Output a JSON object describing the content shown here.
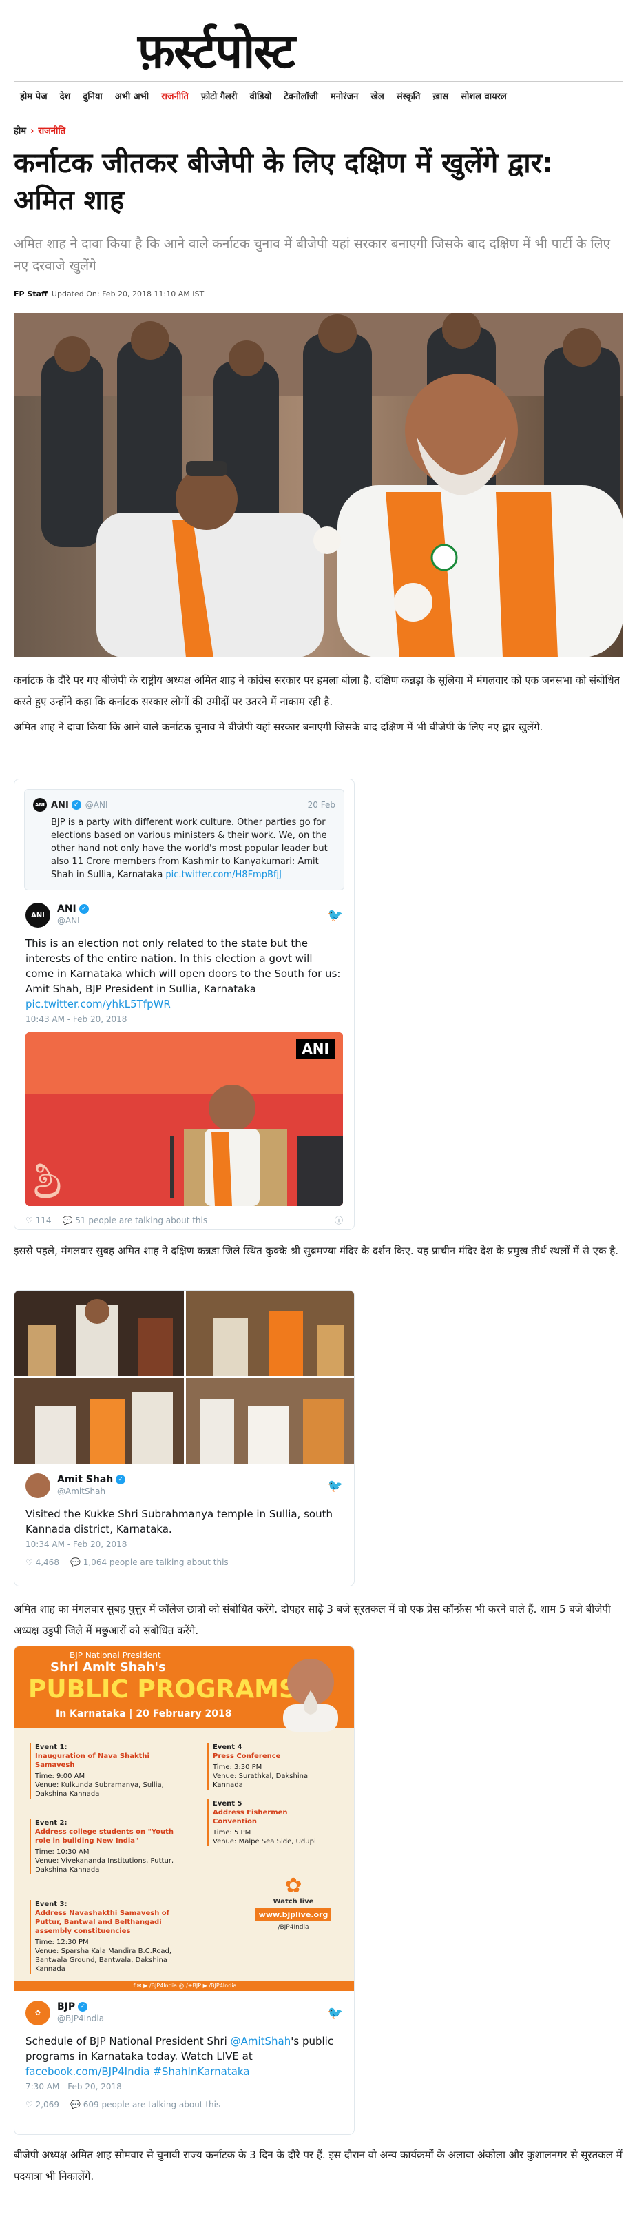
{
  "site": {
    "logo": "फ़र्स्टपोस्ट"
  },
  "nav": [
    "होम पेज",
    "देश",
    "दुनिया",
    "अभी अभी",
    "राजनीति",
    "फ़ोटो गैलरी",
    "वीडियो",
    "टेक्नोलॉजी",
    "मनोरंजन",
    "खेल",
    "संस्कृति",
    "ख़ास",
    "सोशल वायरल"
  ],
  "nav_active": "राजनीति",
  "breadcrumb": {
    "home": "होम",
    "category": "राजनीति"
  },
  "article": {
    "title": "कर्नाटक जीतकर बीजेपी के लिए दक्षिण में खुलेंगे द्वार: अमित शाह",
    "subtitle": "अमित शाह ने दावा किया है कि आने वाले कर्नाटक चुनाव में बीजेपी यहां सरकार बनाएगी जिसके बाद दक्षिण में भी पार्टी के लिए नए दरवाजे खुलेंगे",
    "author": "FP Staff",
    "updated": "Updated On: Feb 20, 2018 11:10 AM IST",
    "p1": "कर्नाटक के दौरे पर गए बीजेपी के राष्ट्रीय अध्यक्ष अमित शाह ने कांग्रेस सरकार पर हमला बोला है. दक्षिण कन्नड़ा के सूलिया में मंगलवार को एक जनसभा को संबोधित करते हुए उन्होंने कहा कि कर्नाटक सरकार लोगों की उमीदों पर उतरने में नाकाम रही है.",
    "p2": "अमित शाह ने दावा किया कि आने वाले कर्नाटक चुनाव में बीजेपी यहां सरकार बनाएगी जिसके बाद दक्षिण में भी बीजेपी के लिए नए द्वार खुलेंगे.",
    "p3": "इससे पहले, मंगलवार सुबह अमित शाह ने दक्षिण कन्नडा जिले स्थित कुक्के श्री सुब्रमण्या मंदिर के दर्शन किए. यह प्राचीन मंदिर देश के प्रमुख तीर्थ स्थलों में से एक है.",
    "p4": "अमित शाह का मंगलवार सुबह पुत्तुर में कॉलेज छात्रों को संबोधित करेंगे. दोपहर साढ़े 3 बजे सूरतकल में वो एक प्रेस कॉन्फ्रेंस भी करने वाले हैं. शाम 5 बजे बीजेपी अध्यक्ष उडुपी जिले में मछुआरों को संबोधित करेंगे.",
    "p5": "बीजेपी अध्यक्ष अमित शाह सोमवार से चुनावी राज्य कर्नाटक के 3 दिन के दौरे पर हैं. इस दौरान वो अन्य कार्यक्रमों के अलावा अंकोला और कुशालनगर से सूरतकल में पदयात्रा भी निकालेंगे."
  },
  "tweet1": {
    "quote_name": "ANI",
    "quote_handle": "@ANI",
    "quote_date": "20 Feb",
    "quote_text": "BJP is a party with different work culture. Other parties go for elections based on various ministers & their work. We, on the other hand not only have the world's most popular leader but also 11 Crore members from Kashmir to Kanyakumari: Amit Shah in Sullia, Karnataka ",
    "quote_link": "pic.twitter.com/H8FmpBfjJ",
    "name": "ANI",
    "handle": "@ANI",
    "text": "This is an election not only related to the state but the interests of the entire nation. In this election a govt will come in Karnataka which will open doors to the South for us: Amit Shah, BJP President in Sullia, Karnataka ",
    "link": "pic.twitter.com/yhkL5TfpWR",
    "time": "10:43 AM - Feb 20, 2018",
    "likes": "114",
    "talking": "51 people are talking about this",
    "watermark": "ANI"
  },
  "tweet2": {
    "name": "Amit Shah",
    "handle": "@AmitShah",
    "text": "Visited the Kukke Shri Subrahmanya temple in Sullia, south Kannada district, Karnataka.",
    "time": "10:34 AM - Feb 20, 2018",
    "likes": "4,468",
    "talking": "1,064 people are talking about this"
  },
  "poster": {
    "kicker": "BJP National President",
    "name": "Shri Amit Shah's",
    "headline": "PUBLIC PROGRAMS",
    "sub": "In Karnataka | 20 February 2018",
    "events": [
      {
        "n": "Event 1:",
        "t": "Inauguration of Nava Shakthi Samavesh",
        "time": "9:00 AM",
        "venue": "Kulkunda Subramanya, Sullia, Dakshina Kannada"
      },
      {
        "n": "Event 2:",
        "t": "Address college students on \"Youth role in building New India\"",
        "time": "10:30 AM",
        "venue": "Vivekananda Institutions, Puttur, Dakshina Kannada"
      },
      {
        "n": "Event 3:",
        "t": "Address Navashakthi Samavesh of Puttur, Bantwal and Belthangadi assembly constituencies",
        "time": "12:30 PM",
        "venue": "Sparsha Kala Mandira B.C.Road, Bantwala Ground, Bantwala, Dakshina Kannada"
      },
      {
        "n": "Event 4",
        "t": "Press Conference",
        "time": "3:30 PM",
        "venue": "Surathkal, Dakshina Kannada"
      },
      {
        "n": "Event 5",
        "t": "Address Fishermen Convention",
        "time": "5 PM",
        "venue": "Malpe Sea Side, Udupi"
      }
    ],
    "time_label": "Time:",
    "venue_label": "Venue:",
    "watch": "Watch live",
    "site": "www.bjplive.org",
    "social": "/BJP4India",
    "footer": "f  ✉  ▶ /BJP4India   @   /+BJP   ▶ /BJP4India"
  },
  "tweet3": {
    "name": "BJP",
    "handle": "@BJP4India",
    "text_a": "Schedule of BJP National President Shri ",
    "mention": "@AmitShah",
    "text_b": "'s public programs in Karnataka today. Watch LIVE at ",
    "link": "facebook.com/BJP4India #ShahInKarnataka",
    "time": "7:30 AM - Feb 20, 2018",
    "likes": "2,069",
    "talking": "609 people are talking about this"
  },
  "colors": {
    "accent": "#e0211a",
    "twitter": "#1da1f2",
    "saffron": "#f07a1c"
  }
}
